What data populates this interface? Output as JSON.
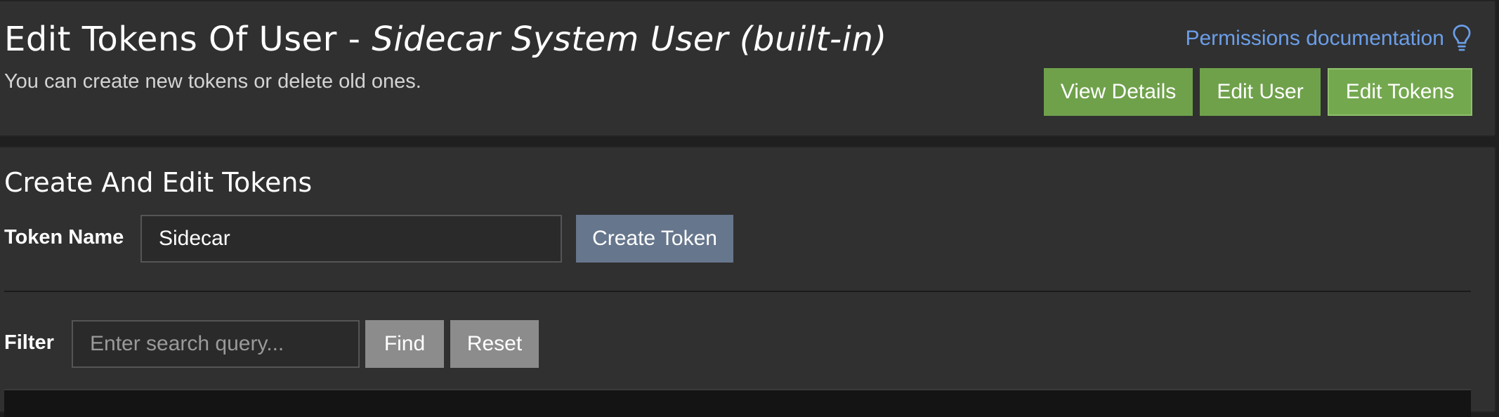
{
  "header": {
    "title_prefix": "Edit Tokens Of User - ",
    "title_user": "Sidecar System User (built-in)",
    "subtitle": "You can create new tokens or delete old ones.",
    "docs_link_label": "Permissions documentation",
    "docs_icon": "lightbulb-icon",
    "actions": {
      "view_details": "View Details",
      "edit_user": "Edit User",
      "edit_tokens": "Edit Tokens"
    }
  },
  "tokens": {
    "section_title": "Create And Edit Tokens",
    "token_name_label": "Token Name",
    "token_name_value": "Sidecar",
    "create_button": "Create Token",
    "filter_label": "Filter",
    "filter_placeholder": "Enter search query...",
    "find_button": "Find",
    "reset_button": "Reset"
  },
  "colors": {
    "accent_green": "#6fa14b",
    "link_blue": "#6b9ee8",
    "slate_button": "#66768c",
    "gray_button": "#8c8c8c"
  }
}
